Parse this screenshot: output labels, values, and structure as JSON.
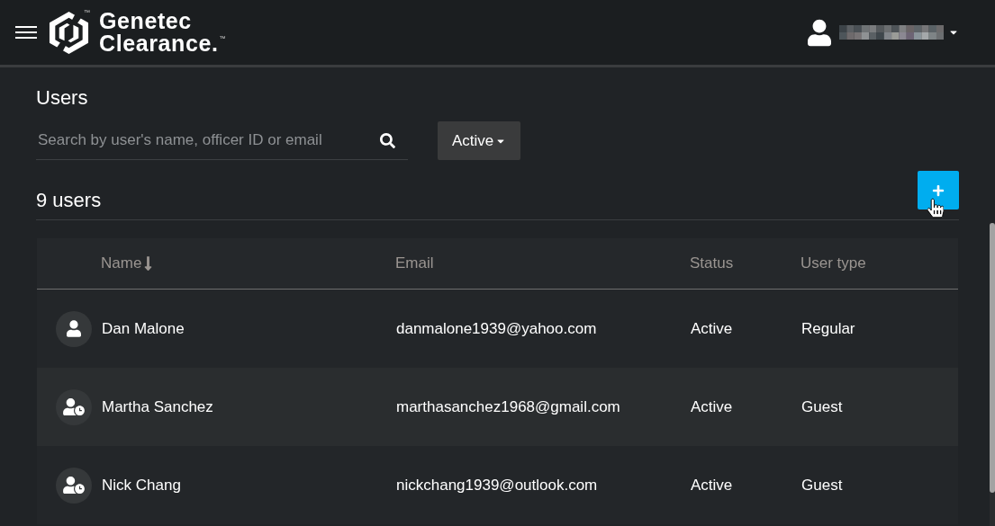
{
  "header": {
    "logo": {
      "mark_trademark": "™",
      "wordmark": [
        "Genetec",
        "Clearance."
      ],
      "wordmark_trademark": "™"
    }
  },
  "page": {
    "title": "Users",
    "search": {
      "placeholder": "Search by user's name, officer ID or email"
    },
    "status_filter": {
      "value": "Active"
    },
    "count": "9 users"
  },
  "table": {
    "columns": [
      {
        "label": "Name",
        "sorted": true
      },
      {
        "label": "Email",
        "sorted": false
      },
      {
        "label": "Status",
        "sorted": false
      },
      {
        "label": "User type",
        "sorted": false
      }
    ],
    "rows": [
      {
        "kind": "regular",
        "name": "Dan Malone",
        "email": "danmalone1939@yahoo.com",
        "status": "Active",
        "user_type": "Regular"
      },
      {
        "kind": "guest",
        "name": "Martha Sanchez",
        "email": "marthasanchez1968@gmail.com",
        "status": "Active",
        "user_type": "Guest"
      },
      {
        "kind": "guest",
        "name": "Nick Chang",
        "email": "nickchang1939@outlook.com",
        "status": "Active",
        "user_type": "Guest"
      }
    ]
  }
}
